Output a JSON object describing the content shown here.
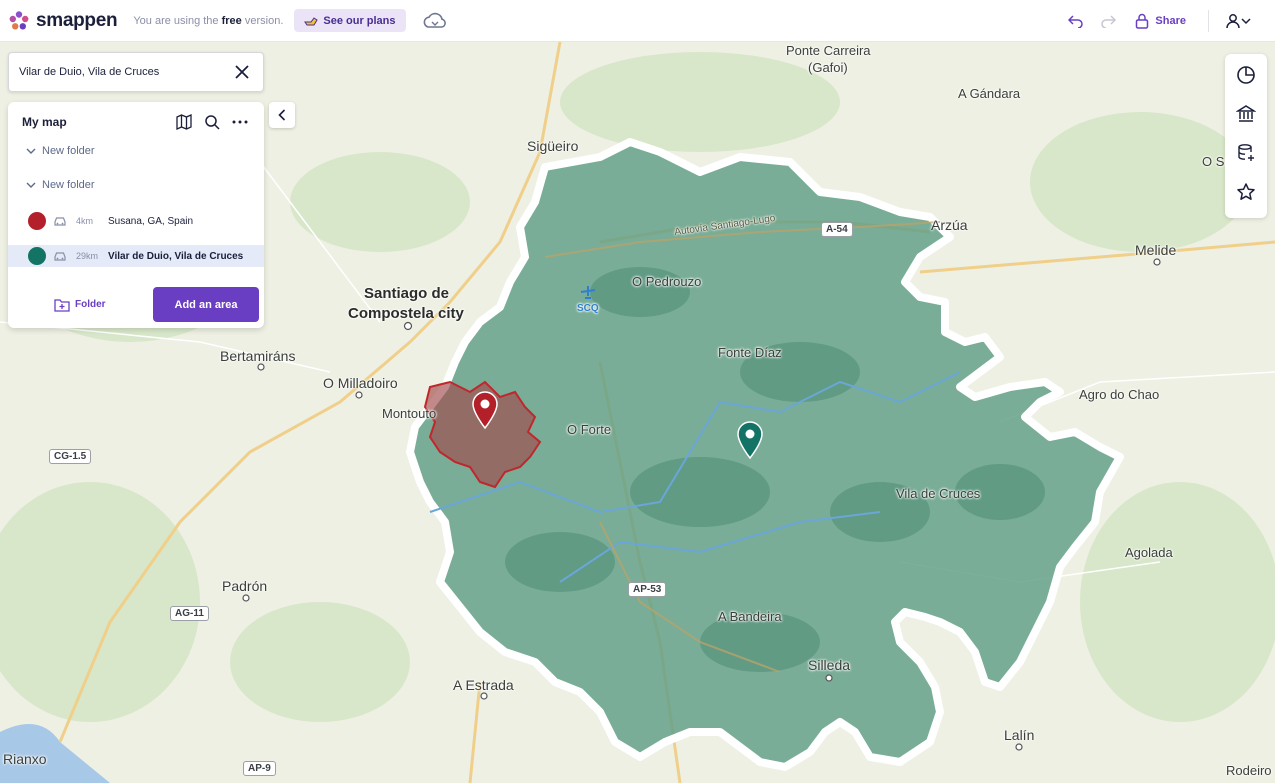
{
  "app": {
    "name": "smappen"
  },
  "topbar": {
    "free_prefix": "You are using the ",
    "free_word": "free",
    "free_suffix": " version.",
    "plans_label": "See our plans",
    "share_label": "Share"
  },
  "search": {
    "value": "Vilar de Duio, Vila de Cruces"
  },
  "panel": {
    "title": "My map",
    "folders": [
      {
        "label": "New folder"
      },
      {
        "label": "New folder"
      }
    ],
    "areas": [
      {
        "color": "#b3202a",
        "distance": "4km",
        "name": "Susana, GA, Spain",
        "active": false
      },
      {
        "color": "#137364",
        "distance": "29km",
        "name": "Vilar de Duio, Vila de Cruces",
        "active": true
      }
    ],
    "folder_button": "Folder",
    "add_button": "Add an area"
  },
  "map": {
    "places": {
      "ponte_carreira": "Ponte Carreira",
      "gafoi": "(Gafoi)",
      "a_gandara": "A Gándara",
      "sigueiro": "Sigüeiro",
      "o_sou": "O Sou",
      "arzua": "Arzúa",
      "melide": "Melide",
      "o_pedrouzo": "O Pedrouzo",
      "santiago_1": "Santiago de",
      "santiago_2": "Compostela city",
      "scq": "SCQ",
      "fonte_diaz": "Fonte Díaz",
      "bertamirans": "Bertamiráns",
      "o_milladoiro": "O Milladoiro",
      "agro_do_chao": "Agro do Chao",
      "montouto": "Montouto",
      "o_forte": "O Forte",
      "vila_de_cruces": "Vila de Cruces",
      "agolada": "Agolada",
      "padron": "Padrón",
      "a_bandeira": "A Bandeira",
      "silleda": "Silleda",
      "a_estrada": "A Estrada",
      "lalin": "Lalín",
      "rianxo": "Rianxo",
      "rodeiro": "Rodeiro",
      "autovia": "Autovía Santiago-Lugo"
    },
    "roads": {
      "a54": "A-54",
      "cg15": "CG-1.5",
      "ap53": "AP-53",
      "ag11": "AG-11",
      "ap9": "AP-9"
    },
    "colors": {
      "isochrone_fill": "#5f9e86",
      "susana_fill": "#a04a4a",
      "accent": "#6a3ec2"
    }
  },
  "icons": {
    "topbar": [
      "smappen-logo-icon",
      "hand-pointer-icon",
      "cloud-sync-icon",
      "undo-icon",
      "redo-icon",
      "lock-icon",
      "user-icon",
      "chevron-down-icon"
    ],
    "panel": [
      "map-icon",
      "search-icon",
      "more-icon",
      "chevron-down-icon",
      "car-icon",
      "folder-add-icon"
    ],
    "right_tools": [
      "pie-chart-icon",
      "bank-icon",
      "database-add-icon",
      "star-icon"
    ]
  }
}
